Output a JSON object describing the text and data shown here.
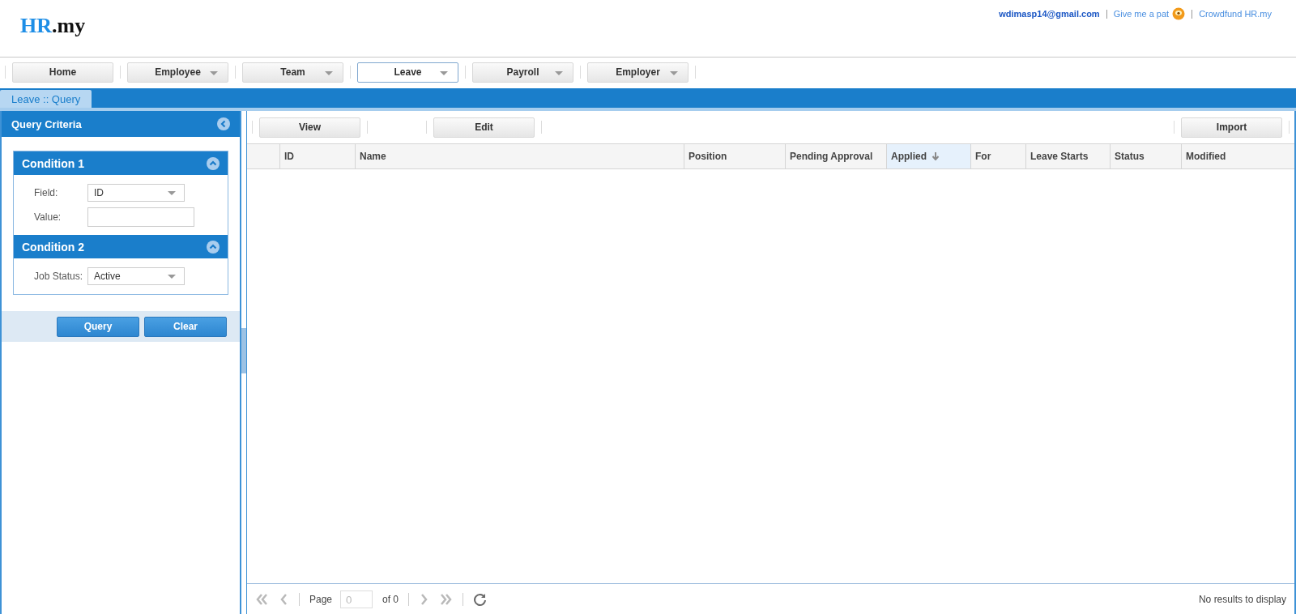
{
  "header": {
    "logo_primary": "HR",
    "logo_secondary": ".my",
    "links": [
      {
        "kind": "account",
        "label": "wdimasp14@gmail.com"
      },
      {
        "kind": "pat",
        "label": "Give me a pat"
      },
      {
        "kind": "link",
        "label": "Crowdfund HR.my"
      }
    ]
  },
  "nav": [
    {
      "label": "Home",
      "dropdown": false,
      "selected": false
    },
    {
      "label": "Employee",
      "dropdown": true,
      "selected": false
    },
    {
      "label": "Team",
      "dropdown": true,
      "selected": false
    },
    {
      "label": "Leave",
      "dropdown": true,
      "selected": true
    },
    {
      "label": "Payroll",
      "dropdown": true,
      "selected": false
    },
    {
      "label": "Employer",
      "dropdown": true,
      "selected": false
    }
  ],
  "tabs": [
    {
      "label": "Leave :: Query",
      "selected": true
    }
  ],
  "query_panel": {
    "title": "Query Criteria",
    "conditions": [
      {
        "title": "Condition 1",
        "expanded": true,
        "fields": [
          {
            "kind": "select",
            "label": "Field:",
            "value": "ID"
          },
          {
            "kind": "text",
            "label": "Value:"
          }
        ]
      },
      {
        "title": "Condition 2",
        "expanded": true,
        "fields": [
          {
            "kind": "select",
            "label": "Job Status:",
            "value": "Active"
          }
        ]
      }
    ],
    "buttons": [
      "Query",
      "Clear"
    ]
  },
  "toolbar": {
    "left": [
      "View",
      "Edit"
    ],
    "right": [
      "Import"
    ]
  },
  "table": {
    "columns": [
      {
        "label": "ID",
        "sorted": false
      },
      {
        "label": "Name",
        "sorted": false
      },
      {
        "label": "Position",
        "sorted": false
      },
      {
        "label": "Pending Approval",
        "sorted": false
      },
      {
        "label": "Applied",
        "sorted": true
      },
      {
        "label": "For",
        "sorted": false
      },
      {
        "label": "Leave Starts",
        "sorted": false
      },
      {
        "label": "Status",
        "sorted": false
      },
      {
        "label": "Modified",
        "sorted": false
      }
    ]
  },
  "pager": {
    "page_label": "Page",
    "page_value": "0",
    "of_label": "of 0",
    "status": "No results to display"
  }
}
